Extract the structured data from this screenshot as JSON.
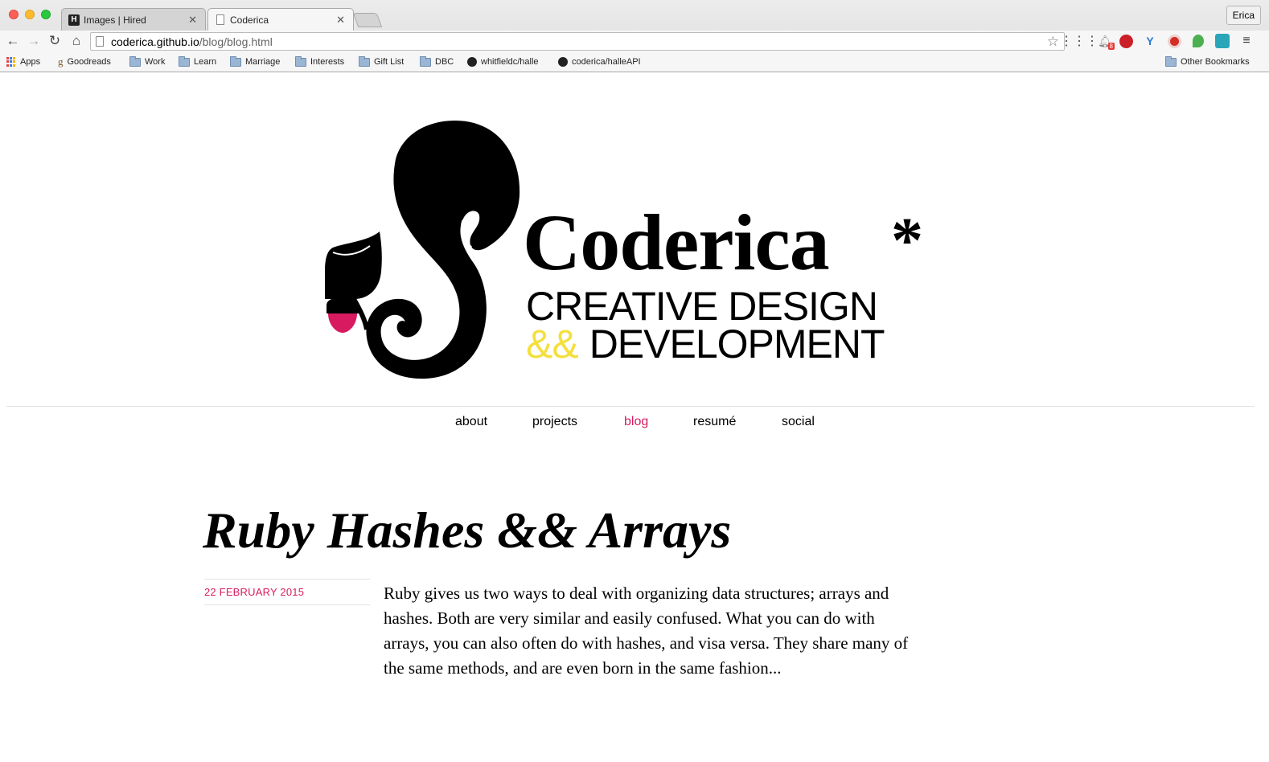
{
  "browser": {
    "tabs": [
      {
        "title": "Images | Hired",
        "favicon": "H",
        "active": false
      },
      {
        "title": "Coderica",
        "favicon": "document-icon",
        "active": true
      }
    ],
    "profile": "Erica",
    "url_host": "coderica.github.io",
    "url_path": "/blog/blog.html",
    "bookmarks": [
      {
        "label": "Apps",
        "icon": "apps-grid-icon"
      },
      {
        "label": "Goodreads",
        "icon": "goodreads-icon"
      },
      {
        "label": "Work",
        "icon": "folder-icon"
      },
      {
        "label": "Learn",
        "icon": "folder-icon"
      },
      {
        "label": "Marriage",
        "icon": "folder-icon"
      },
      {
        "label": "Interests",
        "icon": "folder-icon"
      },
      {
        "label": "Gift List",
        "icon": "folder-icon"
      },
      {
        "label": "DBC",
        "icon": "folder-icon"
      },
      {
        "label": "whitfieldc/halle",
        "icon": "github-icon"
      },
      {
        "label": "coderica/halleAPI",
        "icon": "github-icon"
      }
    ],
    "other_bookmarks": "Other Bookmarks",
    "extension_badge": "8"
  },
  "site": {
    "brand_name": "Coderica",
    "brand_star": "*",
    "tagline_line1": "CREATIVE DESIGN",
    "tagline_amp": "&&",
    "tagline_line2": "DEVELOPMENT",
    "colors": {
      "accent": "#d81b60",
      "amp": "#f5df3c"
    }
  },
  "nav": {
    "items": [
      {
        "label": "about",
        "active": false
      },
      {
        "label": "projects",
        "active": false
      },
      {
        "label": "blog",
        "active": true
      },
      {
        "label": "resumé",
        "active": false
      },
      {
        "label": "social",
        "active": false
      }
    ]
  },
  "post": {
    "title": "Ruby Hashes && Arrays",
    "date": "22 FEBRUARY 2015",
    "excerpt": "Ruby gives us two ways to deal with organizing data structures; arrays and hashes. Both are very similar and easily confused. What you can do with arrays, you can also often do with hashes, and visa versa. They share many of the same methods, and are even born in the same fashion..."
  }
}
